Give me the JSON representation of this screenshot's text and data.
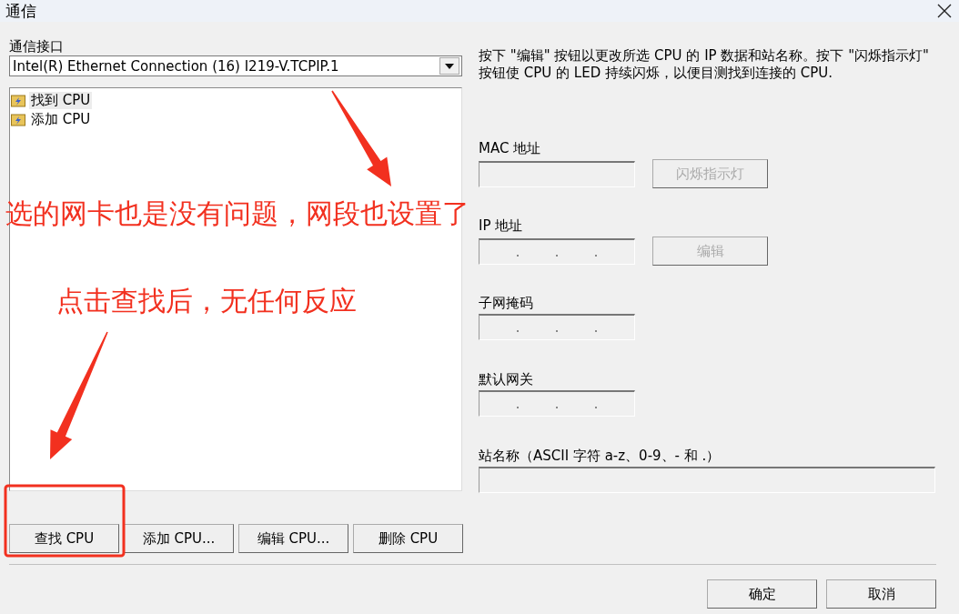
{
  "window": {
    "title": "通信"
  },
  "interface": {
    "label": "通信接口",
    "value": "Intel(R) Ethernet Connection (16) I219-V.TCPIP.1"
  },
  "tree": {
    "items": [
      {
        "label": "找到 CPU",
        "selected": true
      },
      {
        "label": "添加 CPU",
        "selected": false
      }
    ]
  },
  "cpu_buttons": [
    {
      "label": "查找 CPU",
      "disabled": false
    },
    {
      "label": "添加 CPU...",
      "disabled": false
    },
    {
      "label": "编辑 CPU...",
      "disabled": false
    },
    {
      "label": "删除 CPU",
      "disabled": false
    }
  ],
  "description": "按下 \"编辑\" 按钮以更改所选 CPU 的 IP 数据和站名称。按下 \"闪烁指示灯\" 按钮使 CPU 的 LED 持续闪烁，以便目测找到连接的 CPU.",
  "fields": [
    {
      "label": "MAC 地址",
      "kind": "text",
      "button": {
        "label": "闪烁指示灯",
        "disabled": true
      }
    },
    {
      "label": "IP 地址",
      "kind": "ip",
      "button": {
        "label": "编辑",
        "disabled": true
      }
    },
    {
      "label": "子网掩码",
      "kind": "ip"
    },
    {
      "label": "默认网关",
      "kind": "ip"
    },
    {
      "label": "站名称（ASCII 字符 a-z、0-9、- 和 .）",
      "kind": "wide"
    }
  ],
  "dialog_buttons": [
    {
      "label": "确定"
    },
    {
      "label": "取消"
    }
  ],
  "annotations": {
    "notes": [
      "选的网卡也是没有问题，网段也设置了",
      "点击查找后，无任何反应"
    ]
  }
}
